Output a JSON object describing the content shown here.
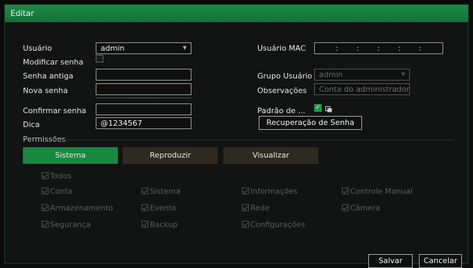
{
  "window": {
    "title": "Editar"
  },
  "form": {
    "user_label": "Usuário",
    "user_value": "admin",
    "modify_password_label": "Modificar senha",
    "old_password_label": "Senha antiga",
    "new_password_label": "Nova senha",
    "confirm_password_label": "Confirmar senha",
    "hint_label": "Dica",
    "hint_value": "@1234567",
    "mac_label": "Usuário MAC",
    "mac_separators": [
      ":",
      ":",
      ":",
      ":",
      ":"
    ],
    "group_label": "Grupo Usuário",
    "group_value": "admin",
    "notes_label": "Observações",
    "notes_value": "Conta do administrador",
    "default_pattern_label": "Padrão de ...",
    "recovery_button": "Recuperação de Senha"
  },
  "permissions": {
    "section_label": "Permissões",
    "tabs": [
      {
        "label": "Sistema",
        "active": true
      },
      {
        "label": "Reproduzir",
        "active": false
      },
      {
        "label": "Visualizar",
        "active": false
      }
    ],
    "all_label": "Todos",
    "items": [
      [
        "Conta",
        "Sistema",
        "Informações",
        "Controle Manual"
      ],
      [
        "Armazenamento",
        "Evento",
        "Rede",
        "Câmera"
      ],
      [
        "Segurança",
        "Backup",
        "Configurações"
      ]
    ]
  },
  "footer": {
    "save": "Salvar",
    "cancel": "Cancelar"
  },
  "colors": {
    "accent": "#17893f",
    "title_bar": "#1a8443",
    "background": "#111412"
  }
}
